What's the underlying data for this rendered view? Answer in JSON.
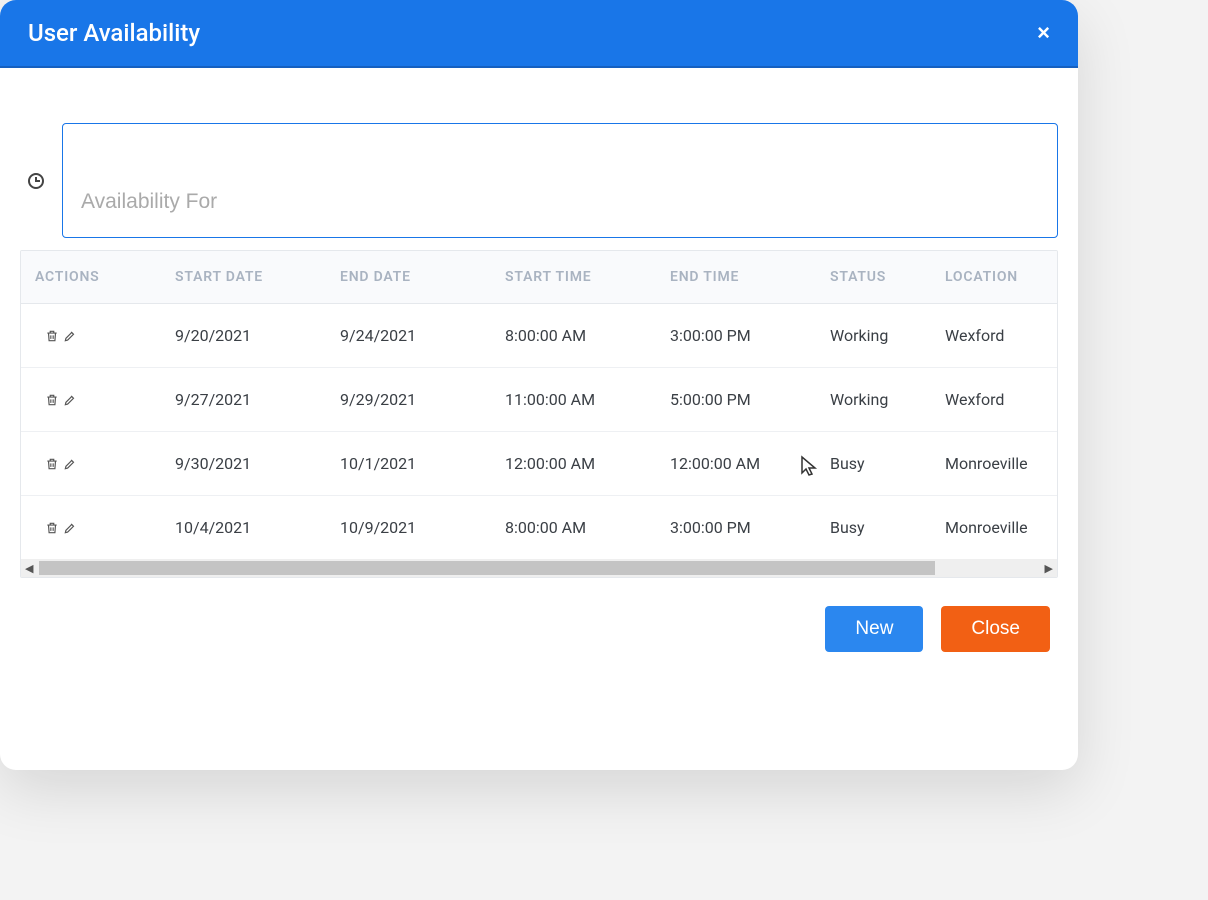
{
  "modal": {
    "title": "User Availability",
    "filter": {
      "placeholder": "Availability For"
    },
    "table": {
      "headers": {
        "actions": "ACTIONS",
        "start_date": "START DATE",
        "end_date": "END DATE",
        "start_time": "START TIME",
        "end_time": "END TIME",
        "status": "STATUS",
        "location": "LOCATION"
      },
      "rows": [
        {
          "start_date": "9/20/2021",
          "end_date": "9/24/2021",
          "start_time": "8:00:00 AM",
          "end_time": "3:00:00 PM",
          "status": "Working",
          "location": "Wexford"
        },
        {
          "start_date": "9/27/2021",
          "end_date": "9/29/2021",
          "start_time": "11:00:00 AM",
          "end_time": "5:00:00 PM",
          "status": "Working",
          "location": "Wexford"
        },
        {
          "start_date": "9/30/2021",
          "end_date": "10/1/2021",
          "start_time": "12:00:00 AM",
          "end_time": "12:00:00 AM",
          "status": "Busy",
          "location": "Monroeville"
        },
        {
          "start_date": "10/4/2021",
          "end_date": "10/9/2021",
          "start_time": "8:00:00 AM",
          "end_time": "3:00:00 PM",
          "status": "Busy",
          "location": "Monroeville"
        }
      ]
    },
    "buttons": {
      "new": "New",
      "close": "Close"
    }
  }
}
